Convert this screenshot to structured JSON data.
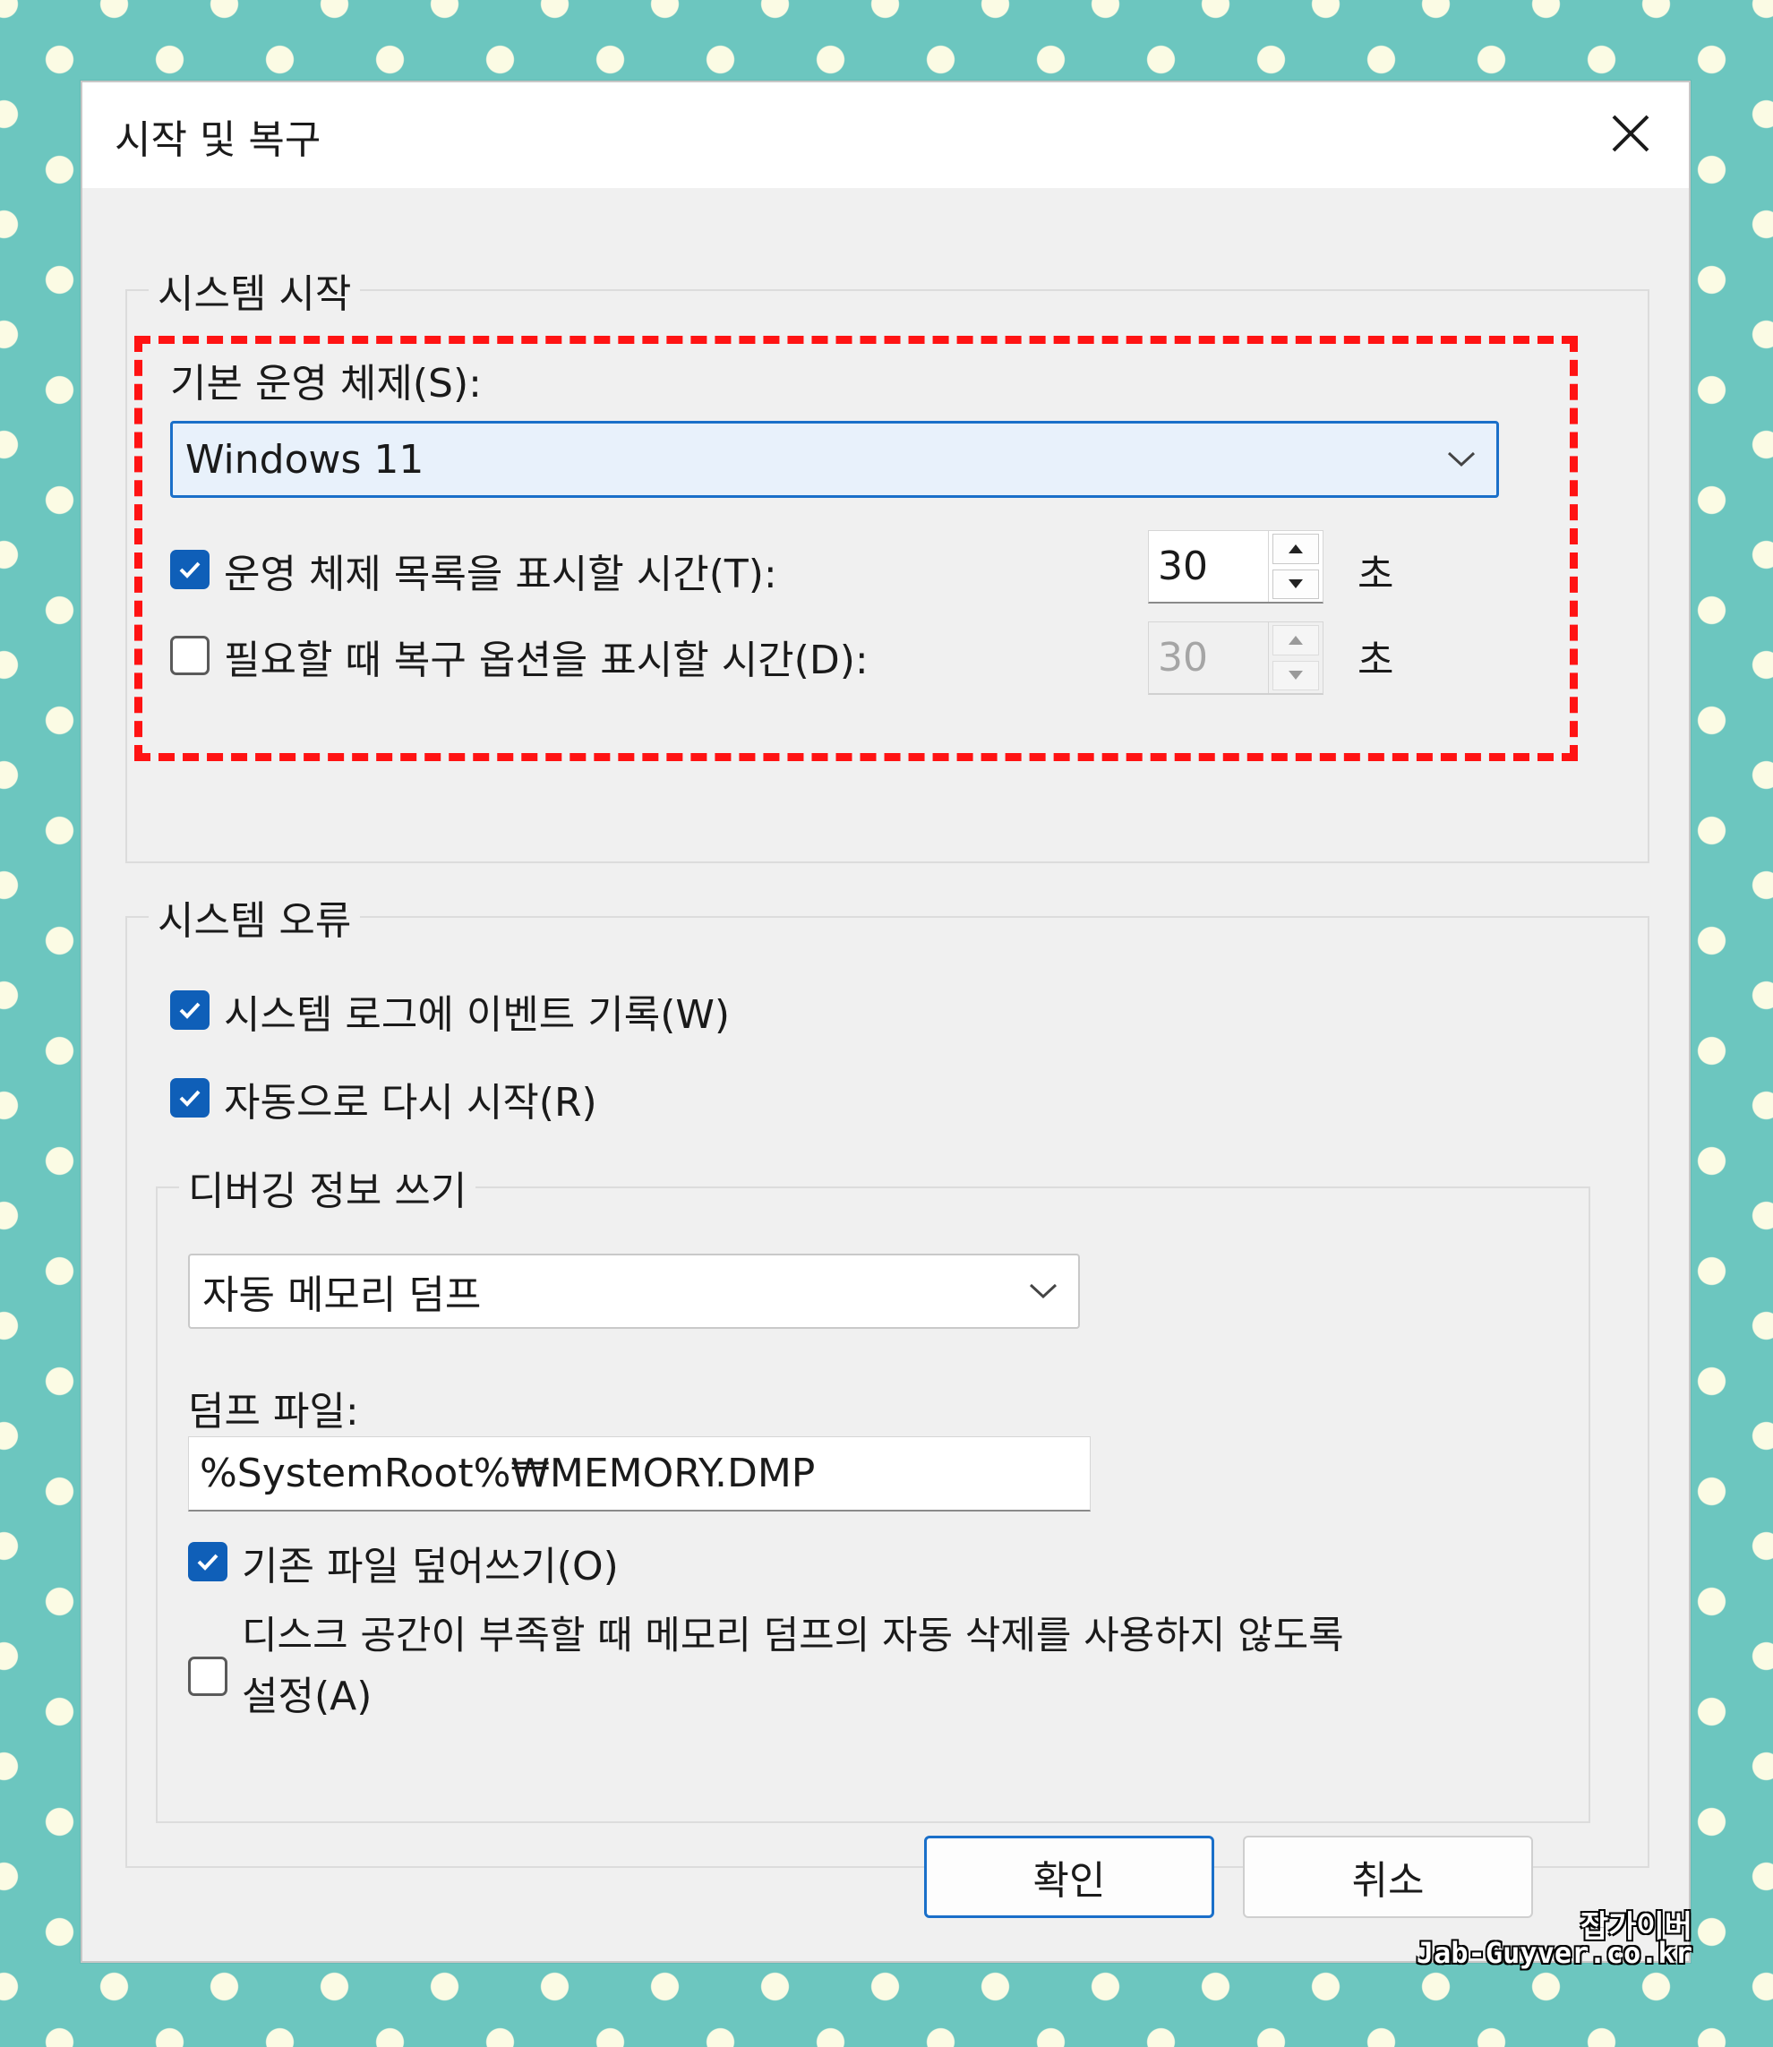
{
  "dialog": {
    "title": "시작 및 복구"
  },
  "startup": {
    "legend": "시스템 시작",
    "default_os_label": "기본 운영 체제(S):",
    "default_os_value": "Windows 11",
    "show_os_list": {
      "label": "운영 체제 목록을 표시할 시간(T):",
      "checked": true,
      "value": "30",
      "unit": "초"
    },
    "show_recovery": {
      "label": "필요할 때 복구 옵션을 표시할 시간(D):",
      "checked": false,
      "value": "30",
      "unit": "초"
    }
  },
  "failure": {
    "legend": "시스템 오류",
    "write_event_label": "시스템 로그에 이벤트 기록(W)",
    "auto_restart_label": "자동으로 다시 시작(R)",
    "debug": {
      "legend": "디버깅 정보 쓰기",
      "dump_type": "자동 메모리 덤프",
      "dump_file_label": "덤프 파일:",
      "dump_file_value": "%SystemRoot%₩MEMORY.DMP",
      "overwrite_label": "기존 파일 덮어쓰기(O)",
      "disable_autodelete_label_line1": "디스크 공간이 부족할 때 메모리 덤프의 자동 삭제를 사용하지 않도록",
      "disable_autodelete_label_line2": "설정(A)"
    }
  },
  "buttons": {
    "ok": "확인",
    "cancel": "취소"
  },
  "watermark": {
    "line1": "잡가이버",
    "line2": "Jab-Guyver.co.kr"
  },
  "colors": {
    "highlight": "#ff1313",
    "accent": "#0f5fb8",
    "background": "#6cc6bf"
  }
}
